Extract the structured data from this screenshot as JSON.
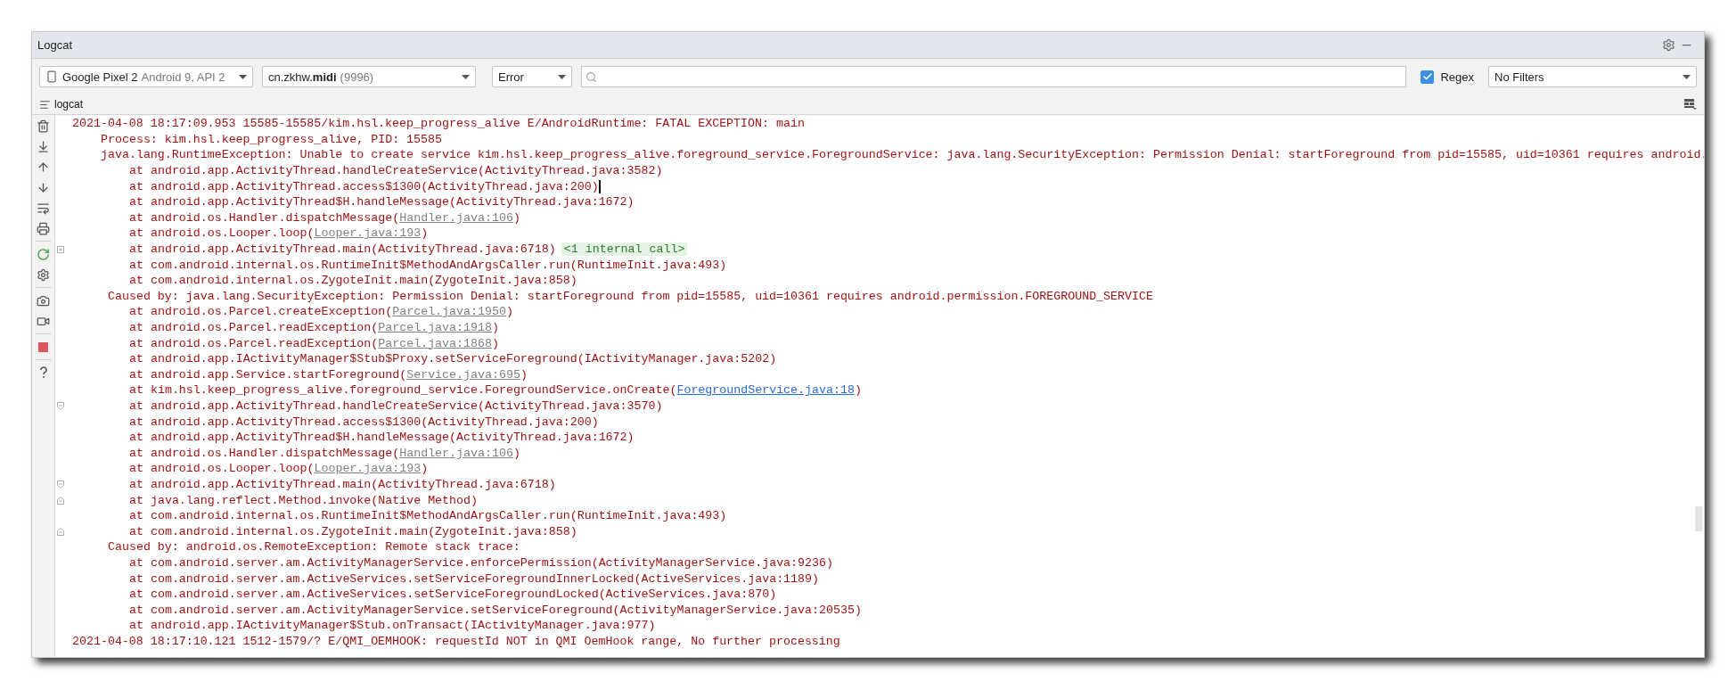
{
  "window": {
    "title": "Logcat"
  },
  "toolbar": {
    "device": {
      "name": "Google Pixel 2",
      "detail": "Android 9, API 2"
    },
    "process": {
      "name": "cn.zkhw.**midi**",
      "pid": "(9996)"
    },
    "level": "Error",
    "regex": {
      "label": "Regex",
      "checked": true
    },
    "filter": "No Filters"
  },
  "tabs": [
    {
      "label": "logcat",
      "selected": true
    }
  ],
  "log": {
    "lines": [
      {
        "kind": "header",
        "segments": [
          {
            "kind": "text",
            "text": "2021-04-08 18:17:09.953 15585-15585/kim.hsl.keep_progress_alive E/AndroidRuntime: FATAL EXCEPTION: main"
          }
        ]
      },
      {
        "kind": "message",
        "segments": [
          {
            "kind": "text",
            "text": "Process: kim.hsl.keep_progress_alive, PID: 15585"
          }
        ]
      },
      {
        "kind": "message",
        "segments": [
          {
            "kind": "text",
            "text": "java.lang.RuntimeException: Unable to create service kim.hsl.keep_progress_alive.foreground_service.ForegroundService: java.lang.SecurityException: Permission Denial: startForeground from pid=15585, uid=10361 requires android."
          }
        ]
      },
      {
        "kind": "frame",
        "segments": [
          {
            "kind": "text",
            "text": "at android.app.ActivityThread.handleCreateService(ActivityThread.java:3582)"
          }
        ]
      },
      {
        "kind": "frame",
        "cursor": true,
        "segments": [
          {
            "kind": "text",
            "text": "at android.app.ActivityThread.access$1300(ActivityThread.java:200)"
          }
        ]
      },
      {
        "kind": "frame",
        "segments": [
          {
            "kind": "text",
            "text": "at android.app.ActivityThread$H.handleMessage(ActivityThread.java:1672)"
          }
        ]
      },
      {
        "kind": "frame",
        "segments": [
          {
            "kind": "text",
            "text": "at android.os.Handler.dispatchMessage("
          },
          {
            "kind": "link",
            "text": "Handler.java:106"
          },
          {
            "kind": "text",
            "text": ")"
          }
        ]
      },
      {
        "kind": "frame",
        "segments": [
          {
            "kind": "text",
            "text": "at android.os.Looper.loop("
          },
          {
            "kind": "link",
            "text": "Looper.java:193"
          },
          {
            "kind": "text",
            "text": ")"
          }
        ]
      },
      {
        "kind": "frame",
        "expandable": true,
        "segments": [
          {
            "kind": "text",
            "text": "at android.app.ActivityThread.main(ActivityThread.java:6718)"
          },
          {
            "kind": "folded",
            "text": "<1 internal call>"
          }
        ]
      },
      {
        "kind": "frame",
        "segments": [
          {
            "kind": "text",
            "text": "at com.android.internal.os.RuntimeInit$MethodAndArgsCaller.run(RuntimeInit.java:493)"
          }
        ]
      },
      {
        "kind": "frame",
        "segments": [
          {
            "kind": "text",
            "text": "at com.android.internal.os.ZygoteInit.main(ZygoteInit.java:858)"
          }
        ]
      },
      {
        "kind": "cause",
        "segments": [
          {
            "kind": "text",
            "text": "Caused by: java.lang.SecurityException: Permission Denial: startForeground from pid=15585, uid=10361 requires android.permission.FOREGROUND_SERVICE"
          }
        ]
      },
      {
        "kind": "frame",
        "segments": [
          {
            "kind": "text",
            "text": "at android.os.Parcel.createException("
          },
          {
            "kind": "link",
            "text": "Parcel.java:1950"
          },
          {
            "kind": "text",
            "text": ")"
          }
        ]
      },
      {
        "kind": "frame",
        "segments": [
          {
            "kind": "text",
            "text": "at android.os.Parcel.readException("
          },
          {
            "kind": "link",
            "text": "Parcel.java:1918"
          },
          {
            "kind": "text",
            "text": ")"
          }
        ]
      },
      {
        "kind": "frame",
        "segments": [
          {
            "kind": "text",
            "text": "at android.os.Parcel.readException("
          },
          {
            "kind": "link",
            "text": "Parcel.java:1868"
          },
          {
            "kind": "text",
            "text": ")"
          }
        ]
      },
      {
        "kind": "frame",
        "segments": [
          {
            "kind": "text",
            "text": "at android.app.IActivityManager$Stub$Proxy.setServiceForeground(IActivityManager.java:5202)"
          }
        ]
      },
      {
        "kind": "frame",
        "segments": [
          {
            "kind": "text",
            "text": "at android.app.Service.startForeground("
          },
          {
            "kind": "link",
            "text": "Service.java:695"
          },
          {
            "kind": "text",
            "text": ")"
          }
        ]
      },
      {
        "kind": "frame",
        "segments": [
          {
            "kind": "text",
            "text": "at kim.hsl.keep_progress_alive.foreground_service.ForegroundService.onCreate("
          },
          {
            "kind": "source",
            "text": "ForegroundService.java:18"
          },
          {
            "kind": "text",
            "text": ")"
          }
        ]
      },
      {
        "kind": "frame",
        "fold_start": true,
        "segments": [
          {
            "kind": "text",
            "text": "at android.app.ActivityThread.handleCreateService(ActivityThread.java:3570)"
          }
        ]
      },
      {
        "kind": "frame",
        "segments": [
          {
            "kind": "text",
            "text": "at android.app.ActivityThread.access$1300(ActivityThread.java:200)"
          }
        ]
      },
      {
        "kind": "frame",
        "segments": [
          {
            "kind": "text",
            "text": "at android.app.ActivityThread$H.handleMessage(ActivityThread.java:1672)"
          }
        ]
      },
      {
        "kind": "frame",
        "segments": [
          {
            "kind": "text",
            "text": "at android.os.Handler.dispatchMessage("
          },
          {
            "kind": "link",
            "text": "Handler.java:106"
          },
          {
            "kind": "text",
            "text": ")"
          }
        ]
      },
      {
        "kind": "frame",
        "segments": [
          {
            "kind": "text",
            "text": "at android.os.Looper.loop("
          },
          {
            "kind": "link",
            "text": "Looper.java:193"
          },
          {
            "kind": "text",
            "text": ")"
          }
        ]
      },
      {
        "kind": "frame",
        "fold_start": true,
        "segments": [
          {
            "kind": "text",
            "text": "at android.app.ActivityThread.main(ActivityThread.java:6718)"
          }
        ]
      },
      {
        "kind": "frame",
        "fold_end": true,
        "segments": [
          {
            "kind": "text",
            "text": "at java.lang.reflect.Method.invoke(Native Method)"
          }
        ]
      },
      {
        "kind": "frame",
        "segments": [
          {
            "kind": "text",
            "text": "at com.android.internal.os.RuntimeInit$MethodAndArgsCaller.run(RuntimeInit.java:493)"
          }
        ]
      },
      {
        "kind": "frame",
        "fold_end": true,
        "segments": [
          {
            "kind": "text",
            "text": "at com.android.internal.os.ZygoteInit.main(ZygoteInit.java:858)"
          }
        ]
      },
      {
        "kind": "cause",
        "segments": [
          {
            "kind": "text",
            "text": "Caused by: android.os.RemoteException: Remote stack trace:"
          }
        ]
      },
      {
        "kind": "frame",
        "segments": [
          {
            "kind": "text",
            "text": "at com.android.server.am.ActivityManagerService.enforcePermission(ActivityManagerService.java:9236)"
          }
        ]
      },
      {
        "kind": "frame",
        "segments": [
          {
            "kind": "text",
            "text": "at com.android.server.am.ActiveServices.setServiceForegroundInnerLocked(ActiveServices.java:1189)"
          }
        ]
      },
      {
        "kind": "frame",
        "segments": [
          {
            "kind": "text",
            "text": "at com.android.server.am.ActiveServices.setServiceForegroundLocked(ActiveServices.java:870)"
          }
        ]
      },
      {
        "kind": "frame",
        "segments": [
          {
            "kind": "text",
            "text": "at com.android.server.am.ActivityManagerService.setServiceForeground(ActivityManagerService.java:20535)"
          }
        ]
      },
      {
        "kind": "frame",
        "segments": [
          {
            "kind": "text",
            "text": "at android.app.IActivityManager$Stub.onTransact(IActivityManager.java:977)"
          }
        ]
      },
      {
        "kind": "header",
        "segments": [
          {
            "kind": "text",
            "text": "2021-04-08 18:17:10.121 1512-1579/? E/QMI_OEMHOOK: requestId NOT in QMI OemHook range, No further processing"
          }
        ]
      }
    ]
  }
}
